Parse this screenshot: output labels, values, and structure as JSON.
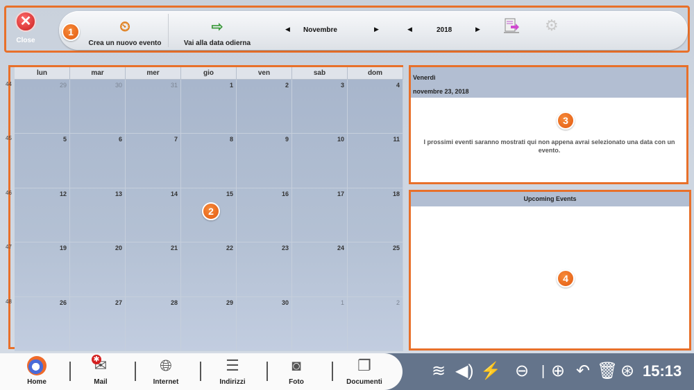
{
  "toolbar": {
    "close_label": "Close",
    "new_event_label": "Crea un nuovo evento",
    "today_label": "Vai alla data odierna",
    "month": "Novembre",
    "year": "2018",
    "badge": "1"
  },
  "calendar": {
    "badge": "2",
    "weekdays": [
      "lun",
      "mar",
      "mer",
      "gio",
      "ven",
      "sab",
      "dom"
    ],
    "week_numbers": [
      "44",
      "45",
      "46",
      "47",
      "48"
    ],
    "days": [
      [
        "29",
        "30",
        "31",
        "1",
        "2",
        "3",
        "4"
      ],
      [
        "5",
        "6",
        "7",
        "8",
        "9",
        "10",
        "11"
      ],
      [
        "12",
        "13",
        "14",
        "15",
        "16",
        "17",
        "18"
      ],
      [
        "19",
        "20",
        "21",
        "22",
        "23",
        "24",
        "25"
      ],
      [
        "26",
        "27",
        "28",
        "29",
        "30",
        "1",
        "2"
      ]
    ]
  },
  "day_panel": {
    "badge": "3",
    "weekday": "Venerdì",
    "date": "novembre 23, 2018",
    "message": "I prossimi eventi saranno mostrati qui non appena avrai selezionato una data con un evento."
  },
  "upcoming": {
    "badge": "4",
    "title": "Upcoming Events"
  },
  "taskbar": {
    "apps": [
      "Home",
      "Mail",
      "Internet",
      "Indirizzi",
      "Foto",
      "Documenti"
    ],
    "clock": "15:13"
  }
}
